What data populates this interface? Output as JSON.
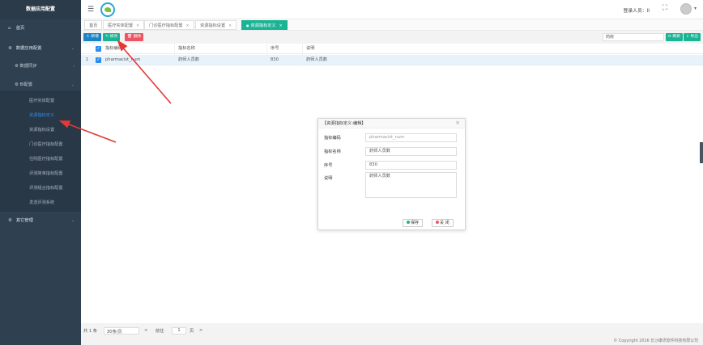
{
  "app": {
    "title": "数据应用配置"
  },
  "sidebar": {
    "items": [
      {
        "label": "首页",
        "icon": "home-icon"
      },
      {
        "label": "数据应用配置",
        "icon": "gear-icon"
      },
      {
        "label": "数据同步",
        "icon": "gear-icon"
      },
      {
        "label": "BI配置",
        "icon": "gear-icon"
      },
      {
        "label": "其它管理",
        "icon": "gear-icon"
      }
    ],
    "bi_children": [
      "医疗实体配置",
      "资源指标定义",
      "资源指标设置",
      "门诊医疗指标配置",
      "住院医疗指标配置",
      "评测简单指标配置",
      "评测组合指标配置",
      "发送评测系统"
    ]
  },
  "header": {
    "user_label": "登录人员：",
    "user_name": "II"
  },
  "tabs": [
    {
      "label": "首页"
    },
    {
      "label": "医疗实体配置"
    },
    {
      "label": "门诊医疗指标配置"
    },
    {
      "label": "资源指标设置"
    },
    {
      "label": "资源指标定义"
    }
  ],
  "toolbar": {
    "add": "新增",
    "edit": "修改",
    "delete": "删除",
    "search_value": "药房",
    "refresh": "刷新",
    "export": "导出"
  },
  "table": {
    "headers": [
      "指标编码",
      "指标名称",
      "序号",
      "说明"
    ],
    "rows": [
      {
        "index": "1",
        "code": "pharmacist_num",
        "name": "药师人员数",
        "order": "830",
        "desc": "药师人员数"
      }
    ]
  },
  "pager": {
    "total": "共 1 条",
    "page_size": "20条/页",
    "prev": "<",
    "goto": "前往",
    "page": "1",
    "page_suffix": "页",
    "next": ">"
  },
  "copyright": "© Copyright 2016 长沙康讯软件科技有限公司",
  "modal": {
    "title": "【资源指标定义:编辑】",
    "fields": [
      {
        "label": "指标编码",
        "value": "pharmacist_num"
      },
      {
        "label": "指标名称",
        "value": "药师人员数"
      },
      {
        "label": "序号",
        "value": "830"
      },
      {
        "label": "说明",
        "value": "药师人员数"
      }
    ],
    "save": "保存",
    "close": "关 闭"
  },
  "colors": {
    "sidebar_bg": "#2f4050",
    "accent_green": "#1ab394",
    "accent_blue": "#1c84c6",
    "accent_red": "#ed5565",
    "annotation_red": "#e53935"
  }
}
